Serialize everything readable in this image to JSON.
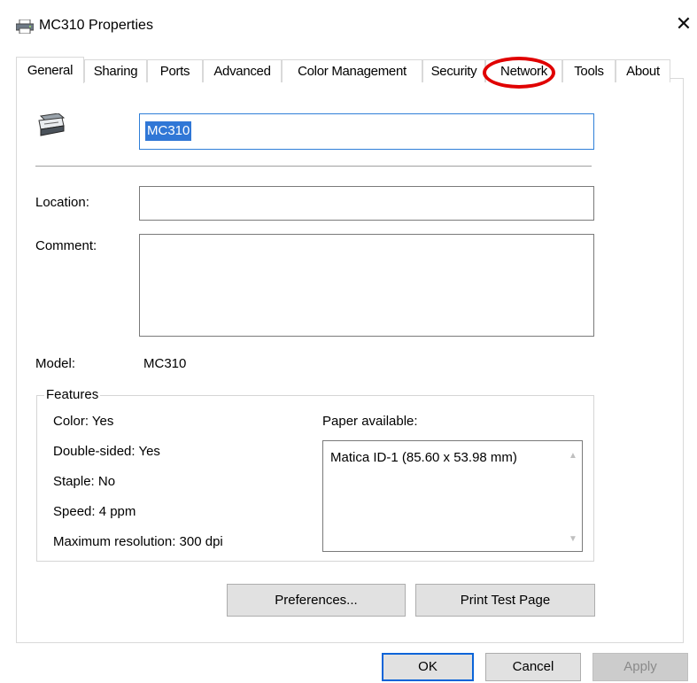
{
  "window": {
    "title": "MC310 Properties",
    "icon": "printer-icon",
    "close_glyph": "✕"
  },
  "tabs": [
    {
      "label": "General",
      "active": true
    },
    {
      "label": "Sharing",
      "active": false
    },
    {
      "label": "Ports",
      "active": false
    },
    {
      "label": "Advanced",
      "active": false
    },
    {
      "label": "Color Management",
      "active": false
    },
    {
      "label": "Security",
      "active": false
    },
    {
      "label": "Network",
      "active": false,
      "highlighted": true
    },
    {
      "label": "Tools",
      "active": false
    },
    {
      "label": "About",
      "active": false
    }
  ],
  "general": {
    "printer_name": "MC310",
    "location_label": "Location:",
    "location_value": "",
    "comment_label": "Comment:",
    "comment_value": "",
    "model_label": "Model:",
    "model_value": "MC310"
  },
  "features": {
    "legend": "Features",
    "color": "Color: Yes",
    "double_sided": "Double-sided: Yes",
    "staple": "Staple: No",
    "speed": "Speed: 4 ppm",
    "max_resolution": "Maximum resolution: 300 dpi",
    "paper_label": "Paper available:",
    "paper_items": [
      "Matica ID-1 (85.60 x 53.98 mm)"
    ]
  },
  "buttons": {
    "preferences": "Preferences...",
    "print_test_page": "Print Test Page",
    "ok": "OK",
    "cancel": "Cancel",
    "apply": "Apply"
  },
  "colors": {
    "highlight_oval": "#e00000",
    "selection": "#3077d6",
    "focus_border": "#0a64d8"
  }
}
